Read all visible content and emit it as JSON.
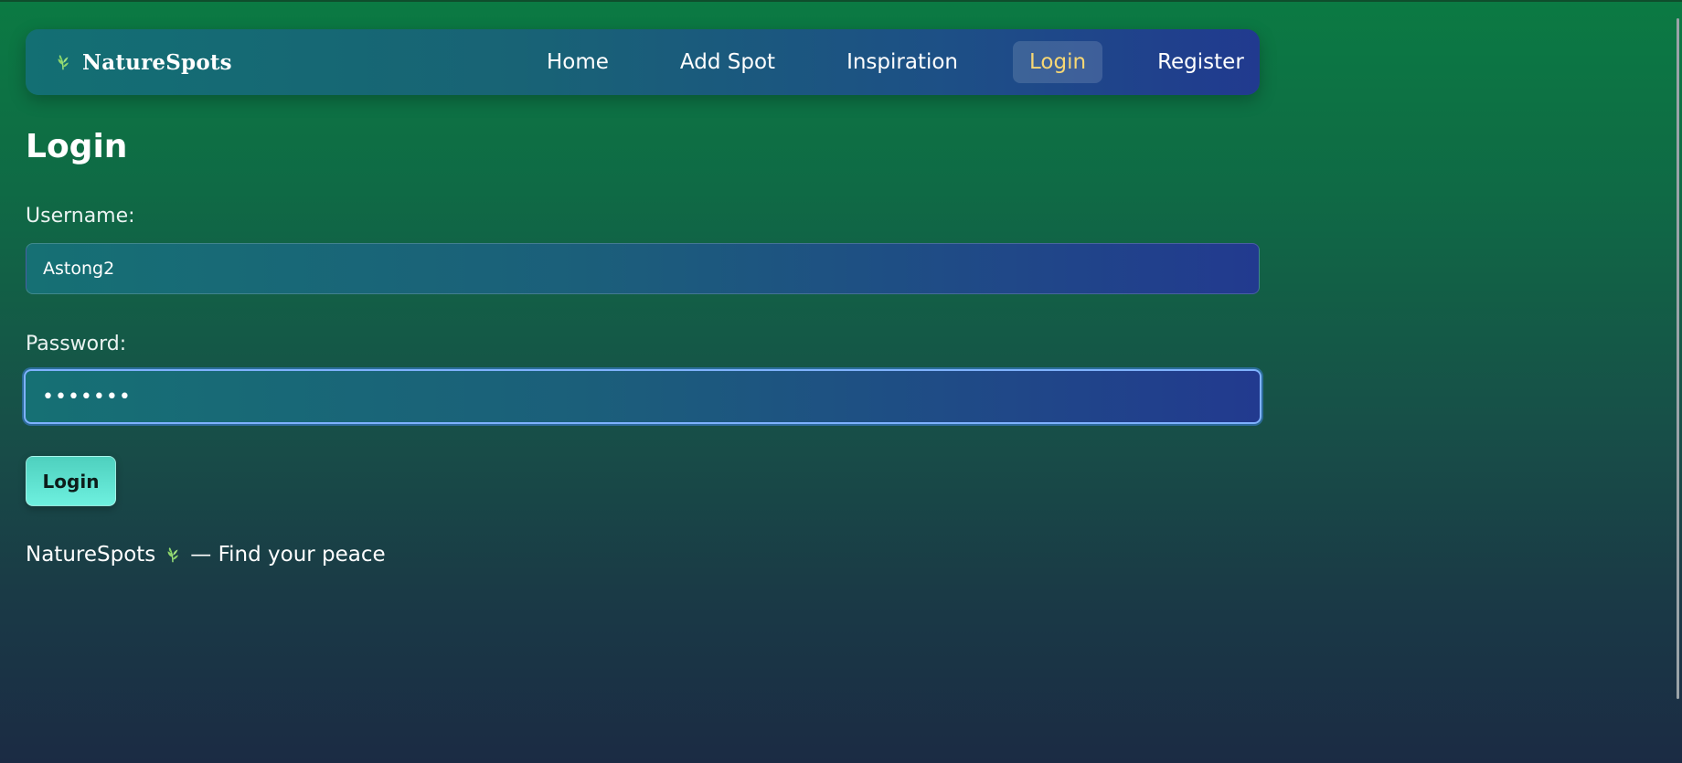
{
  "brand": {
    "name": "NatureSpots",
    "icon": "leaf-icon"
  },
  "nav": {
    "items": [
      {
        "label": "Home",
        "active": false
      },
      {
        "label": "Add Spot",
        "active": false
      },
      {
        "label": "Inspiration",
        "active": false
      },
      {
        "label": "Login",
        "active": true
      },
      {
        "label": "Register",
        "active": false
      }
    ]
  },
  "page": {
    "title": "Login"
  },
  "form": {
    "username_label": "Username:",
    "username_value": "Astong2",
    "password_label": "Password:",
    "password_value": "•••••••",
    "submit_label": "Login"
  },
  "footer": {
    "brand": "NatureSpots",
    "icon": "leaf-icon",
    "tagline": "— Find your peace"
  },
  "colors": {
    "active_nav_text": "#f7d774",
    "button_bg": "#6ef0df",
    "focus_ring": "#7fb2ff"
  }
}
